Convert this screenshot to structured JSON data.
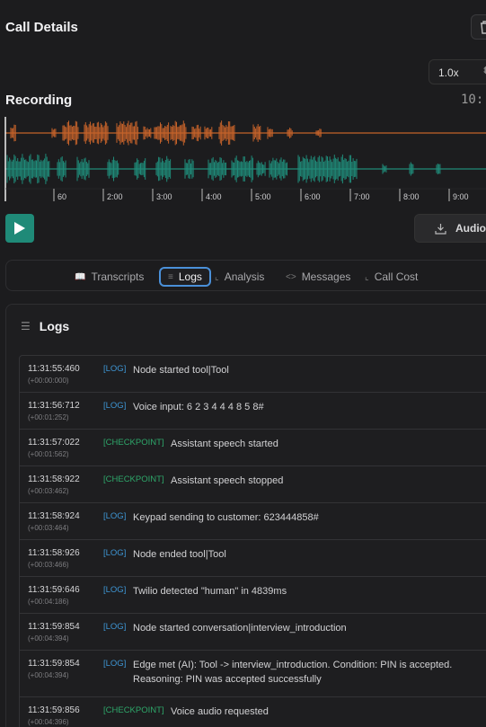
{
  "header": {
    "title": "Call Details"
  },
  "playback": {
    "speed": "1.0x"
  },
  "recording": {
    "label": "Recording",
    "time": "10:",
    "ticks": [
      "60",
      "2:00",
      "3:00",
      "4:00",
      "5:00",
      "6:00",
      "7:00",
      "8:00",
      "9:00"
    ],
    "audio_label": "Audio",
    "colors": {
      "agent": "#c4622a",
      "customer": "#1f8a78"
    }
  },
  "tabs": [
    {
      "label": "Transcripts",
      "icon": "book-icon"
    },
    {
      "label": "Logs",
      "icon": "list-icon",
      "active": true
    },
    {
      "label": "Analysis",
      "icon": "chart-icon"
    },
    {
      "label": "Messages",
      "icon": "code-icon"
    },
    {
      "label": "Call Cost",
      "icon": "bar-chart-icon"
    }
  ],
  "logs": {
    "title": "Logs",
    "entries": [
      {
        "time": "11:31:55:460",
        "rel": "(+00:00:000)",
        "type": "[LOG]",
        "msg": "Node started tool|Tool"
      },
      {
        "time": "11:31:56:712",
        "rel": "(+00:01:252)",
        "type": "[LOG]",
        "msg": "Voice input: 6 2 3 4 4 4 8 5 8#"
      },
      {
        "time": "11:31:57:022",
        "rel": "(+00:01:562)",
        "type": "[CHECKPOINT]",
        "msg": "Assistant speech started"
      },
      {
        "time": "11:31:58:922",
        "rel": "(+00:03:462)",
        "type": "[CHECKPOINT]",
        "msg": "Assistant speech stopped"
      },
      {
        "time": "11:31:58:924",
        "rel": "(+00:03:464)",
        "type": "[LOG]",
        "msg": "Keypad sending to customer: 623444858#"
      },
      {
        "time": "11:31:58:926",
        "rel": "(+00:03:466)",
        "type": "[LOG]",
        "msg": "Node ended tool|Tool"
      },
      {
        "time": "11:31:59:646",
        "rel": "(+00:04:186)",
        "type": "[LOG]",
        "msg": "Twilio detected \"human\" in 4839ms"
      },
      {
        "time": "11:31:59:854",
        "rel": "(+00:04:394)",
        "type": "[LOG]",
        "msg": "Node started conversation|interview_introduction"
      },
      {
        "time": "11:31:59:854",
        "rel": "(+00:04:394)",
        "type": "[LOG]",
        "msg": "Edge met (AI): Tool -> interview_introduction. Condition: PIN is accepted. Reasoning: PIN was accepted successfully"
      },
      {
        "time": "11:31:59:856",
        "rel": "(+00:04:396)",
        "type": "[CHECKPOINT]",
        "msg": "Voice audio requested"
      }
    ]
  }
}
